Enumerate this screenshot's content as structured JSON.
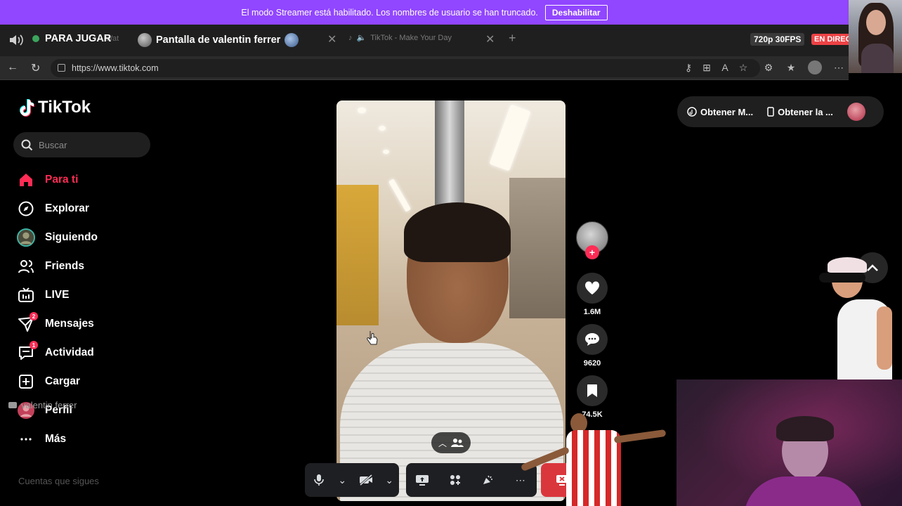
{
  "banner": {
    "message": "El modo Streamer está habilitado. Los nombres de usuario se han truncado.",
    "button": "Deshabilitar"
  },
  "tabs": {
    "channel_name": "PARA JUGAR",
    "channel_ghost": "Wat",
    "screen_title": "Pantalla de valentin ferrer",
    "browser_tab": "TikTok - Make Your Day",
    "quality": "720p 30FPS",
    "live": "EN DIRECTO"
  },
  "browser": {
    "url": "https://www.tiktok.com"
  },
  "tiktok": {
    "logo": "TikTok",
    "search_placeholder": "Buscar",
    "nav": [
      {
        "label": "Para ti",
        "icon": "home-icon",
        "active": true
      },
      {
        "label": "Explorar",
        "icon": "compass-icon"
      },
      {
        "label": "Siguiendo",
        "icon": "following-avatar-icon"
      },
      {
        "label": "Friends",
        "icon": "friends-icon"
      },
      {
        "label": "LIVE",
        "icon": "live-tv-icon"
      },
      {
        "label": "Mensajes",
        "icon": "messages-icon",
        "badge": "2"
      },
      {
        "label": "Actividad",
        "icon": "activity-icon",
        "badge": "1"
      },
      {
        "label": "Cargar",
        "icon": "upload-icon"
      },
      {
        "label": "Perfil",
        "icon": "profile-avatar-icon"
      },
      {
        "label": "Más",
        "icon": "more-icon"
      }
    ],
    "following_title": "Cuentas que sigues",
    "top_buttons": [
      "Obtener M...",
      "Obtener la ..."
    ],
    "actions": {
      "likes": "1.6M",
      "comments": "9620",
      "saves": "74.5K"
    }
  },
  "call": {
    "user": "valentin ferrer"
  },
  "colors": {
    "banner": "#9146ff",
    "tiktok_accent": "#fe2c55",
    "live_red": "#ed4245",
    "leave_red": "#da373c"
  }
}
